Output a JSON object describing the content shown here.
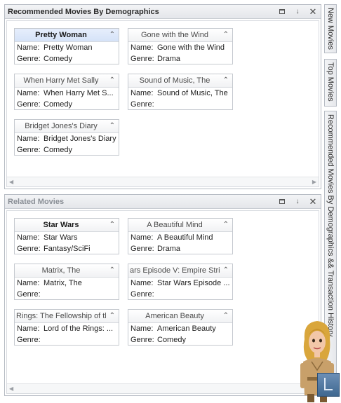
{
  "panels": {
    "recommended": {
      "title": "Recommended Movies By Demographics",
      "cards": [
        {
          "title": "Pretty Woman",
          "name": "Pretty Woman",
          "genre": "Comedy"
        },
        {
          "title": "Gone with the Wind",
          "name": "Gone with the Wind",
          "genre": "Drama"
        },
        {
          "title": "When Harry Met Sally",
          "name": "When Harry Met S...",
          "genre": "Comedy"
        },
        {
          "title": "Sound of Music, The",
          "name": "Sound of Music, The",
          "genre": ""
        },
        {
          "title": "Bridget Jones's Diary",
          "name": "Bridget Jones's Diary",
          "genre": "Comedy"
        }
      ]
    },
    "related": {
      "title": "Related Movies",
      "cards": [
        {
          "title": "Star Wars",
          "name": "Star Wars",
          "genre": "Fantasy/SciFi"
        },
        {
          "title": "A Beautiful Mind",
          "name": "A Beautiful Mind",
          "genre": "Drama"
        },
        {
          "title": "Matrix, The",
          "name": "Matrix, The",
          "genre": ""
        },
        {
          "title": "ars Episode V: Empire Strik",
          "name": "Star Wars Episode ...",
          "genre": ""
        },
        {
          "title": "Rings: The Fellowship of th",
          "name": "Lord of the Rings: ...",
          "genre": ""
        },
        {
          "title": "American Beauty",
          "name": "American Beauty",
          "genre": "Comedy"
        }
      ]
    }
  },
  "labels": {
    "name": "Name:",
    "genre": "Genre:"
  },
  "rail_tabs": {
    "new_movies": "New Movies",
    "top_movies": "Top Movies",
    "recommended_history": "Recommended Movies By Demographics && Transaction History"
  },
  "icons": {
    "maximize": "maximize-icon",
    "pin": "pin-icon",
    "close": "close-icon",
    "collapse": "chevron-up-icon"
  }
}
